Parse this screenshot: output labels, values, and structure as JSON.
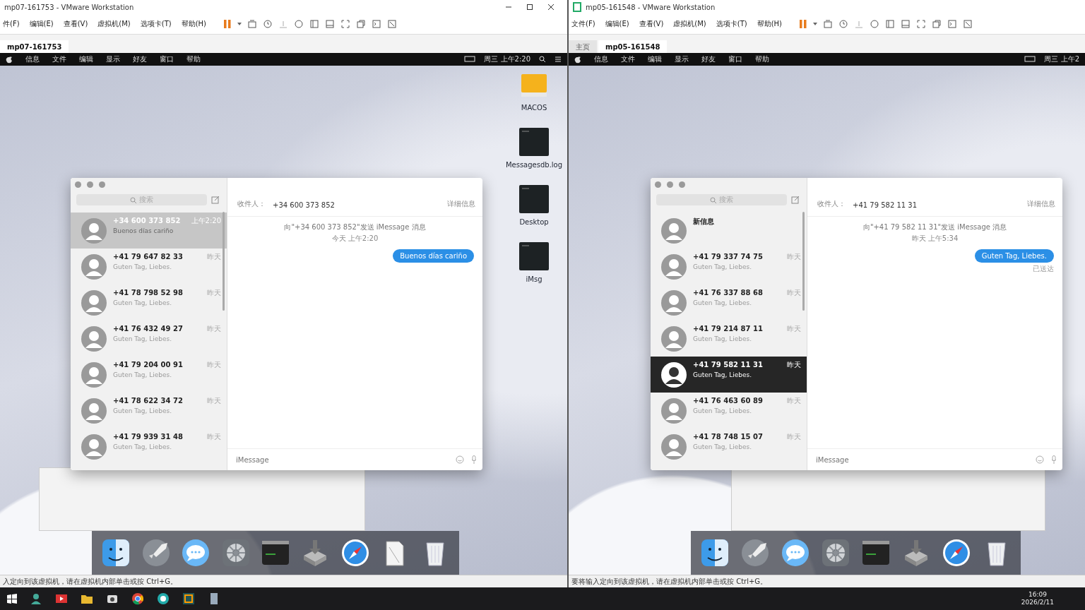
{
  "vms": [
    {
      "title": "mp07-161753 - VMware Workstation",
      "menu": [
        "件(F)",
        "编辑(E)",
        "查看(V)",
        "虚拟机(M)",
        "选项卡(T)",
        "帮助(H)"
      ],
      "tabs": [
        {
          "label": "mp07-161753",
          "selected": true
        }
      ],
      "guest": {
        "menubar": {
          "items": [
            "信息",
            "文件",
            "编辑",
            "显示",
            "好友",
            "窗口",
            "帮助"
          ],
          "clock": "周三 上午2:20"
        },
        "desktop_icons": [
          {
            "label": "MACOS",
            "kind": "drive"
          },
          {
            "label": "Messagesdb.log",
            "kind": "document"
          },
          {
            "label": "Desktop",
            "kind": "document"
          },
          {
            "label": "iMsg",
            "kind": "document"
          }
        ],
        "messages": {
          "focused": false,
          "search_placeholder": "搜索",
          "recipient_label": "收件人：",
          "recipient": "+34 600 373 852",
          "details": "详细信息",
          "conversations": [
            {
              "name": "+34 600 373 852",
              "time": "上午2:20",
              "preview": "Buenos días cariño",
              "selected": true
            },
            {
              "name": "+41 79 647 82 33",
              "time": "昨天",
              "preview": "Guten Tag, Liebes.",
              "selected": false
            },
            {
              "name": "+41 78 798 52 98",
              "time": "昨天",
              "preview": "Guten Tag, Liebes.",
              "selected": false
            },
            {
              "name": "+41 76 432 49 27",
              "time": "昨天",
              "preview": "Guten Tag, Liebes.",
              "selected": false
            },
            {
              "name": "+41 79 204 00 91",
              "time": "昨天",
              "preview": "Guten Tag, Liebes.",
              "selected": false
            },
            {
              "name": "+41 78 622 34 72",
              "time": "昨天",
              "preview": "Guten Tag, Liebes.",
              "selected": false
            },
            {
              "name": "+41 79 939 31 48",
              "time": "昨天",
              "preview": "Guten Tag, Liebes.",
              "selected": false
            }
          ],
          "chat": {
            "intro": "向\"+34 600 373 852\"发送 iMessage 消息",
            "timestamp": "今天 上午2:20",
            "messages": [
              {
                "text": "Buenos días cariño"
              }
            ]
          },
          "input_placeholder": "iMessage"
        },
        "dock": [
          {
            "kind": "finder"
          },
          {
            "kind": "launchpad"
          },
          {
            "kind": "messages"
          },
          {
            "kind": "settings"
          },
          {
            "kind": "terminal"
          },
          {
            "kind": "installer"
          },
          {
            "kind": "safari"
          },
          {
            "kind": "preview"
          },
          {
            "kind": "trash"
          }
        ]
      },
      "status": "入定向到该虚拟机，请在虚拟机内部单击或按 Ctrl+G。"
    },
    {
      "title": "mp05-161548 - VMware Workstation",
      "menu": [
        "文件(F)",
        "编辑(E)",
        "查看(V)",
        "虚拟机(M)",
        "选项卡(T)",
        "帮助(H)"
      ],
      "tabs": [
        {
          "label": "主页",
          "selected": false
        },
        {
          "label": "mp05-161548",
          "selected": true
        }
      ],
      "guest": {
        "menubar": {
          "items": [
            "信息",
            "文件",
            "编辑",
            "显示",
            "好友",
            "窗口",
            "帮助"
          ],
          "clock": "周三 上午2"
        },
        "messages": {
          "focused": true,
          "search_placeholder": "搜索",
          "recipient_label": "收件人：",
          "recipient": "+41 79 582 11 31",
          "details": "详细信息",
          "conversations": [
            {
              "name": "新信息",
              "selected": false
            },
            {
              "name": "+41 79 337 74 75",
              "time": "昨天",
              "preview": "Guten Tag, Liebes.",
              "selected": false
            },
            {
              "name": "+41 76 337 88 68",
              "time": "昨天",
              "preview": "Guten Tag, Liebes.",
              "selected": false
            },
            {
              "name": "+41 79 214 87 11",
              "time": "昨天",
              "preview": "Guten Tag, Liebes.",
              "selected": false
            },
            {
              "name": "+41 79 582 11 31",
              "time": "昨天",
              "preview": "Guten Tag, Liebes.",
              "selected": true
            },
            {
              "name": "+41 76 463 60 89",
              "time": "昨天",
              "preview": "Guten Tag, Liebes.",
              "selected": false
            },
            {
              "name": "+41 78 748 15 07",
              "time": "昨天",
              "preview": "Guten Tag, Liebes.",
              "selected": false
            }
          ],
          "chat": {
            "intro": "向\"+41 79 582 11 31\"发送 iMessage 消息",
            "timestamp": "昨天 上午5:34",
            "messages": [
              {
                "text": "Guten Tag, Liebes.",
                "status": "已送达"
              }
            ]
          },
          "input_placeholder": "iMessage"
        },
        "dock": [
          {
            "kind": "finder"
          },
          {
            "kind": "launchpad"
          },
          {
            "kind": "messages"
          },
          {
            "kind": "settings"
          },
          {
            "kind": "terminal"
          },
          {
            "kind": "installer"
          },
          {
            "kind": "safari"
          },
          {
            "kind": "trash"
          }
        ]
      },
      "status": "要将输入定向到该虚拟机，请在虚拟机内部单击或按 Ctrl+G。"
    }
  ],
  "taskbar": {
    "time": "16:09",
    "date": "2026/2/11"
  }
}
